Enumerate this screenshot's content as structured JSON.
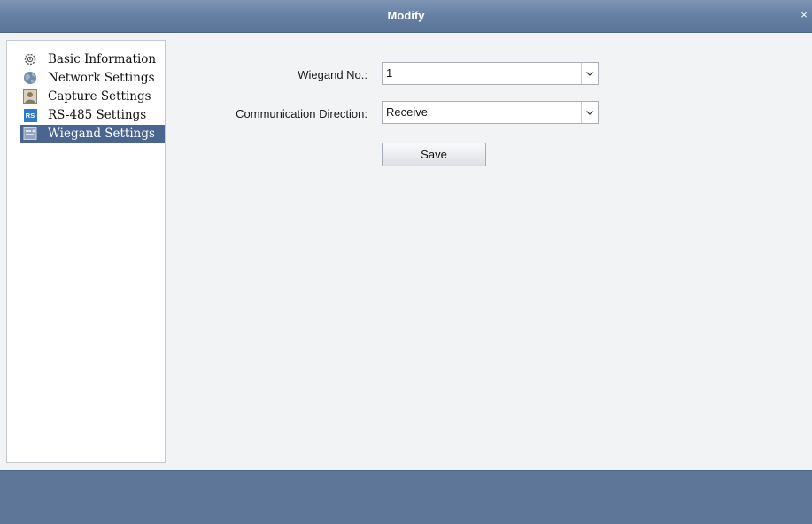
{
  "window": {
    "title": "Modify",
    "close_glyph": "×"
  },
  "sidebar": {
    "items": [
      {
        "label": "Basic Information",
        "icon": "gear-cluster-icon",
        "selected": false
      },
      {
        "label": "Network Settings",
        "icon": "globe-icon",
        "selected": false
      },
      {
        "label": "Capture Settings",
        "icon": "capture-person-icon",
        "selected": false
      },
      {
        "label": "RS-485 Settings",
        "icon": "rs-badge-icon",
        "selected": false
      },
      {
        "label": "Wiegand Settings",
        "icon": "wiegand-icon",
        "selected": true
      }
    ],
    "rs_badge_text": "RS"
  },
  "form": {
    "wiegand_no": {
      "label": "Wiegand No.:",
      "value": "1"
    },
    "direction": {
      "label": "Communication Direction:",
      "value": "Receive"
    },
    "save_label": "Save"
  },
  "colors": {
    "titlebar": "#6580a4",
    "selected_row": "#4b6591",
    "footer": "#5e7799",
    "content_bg": "#f2f3f5"
  }
}
